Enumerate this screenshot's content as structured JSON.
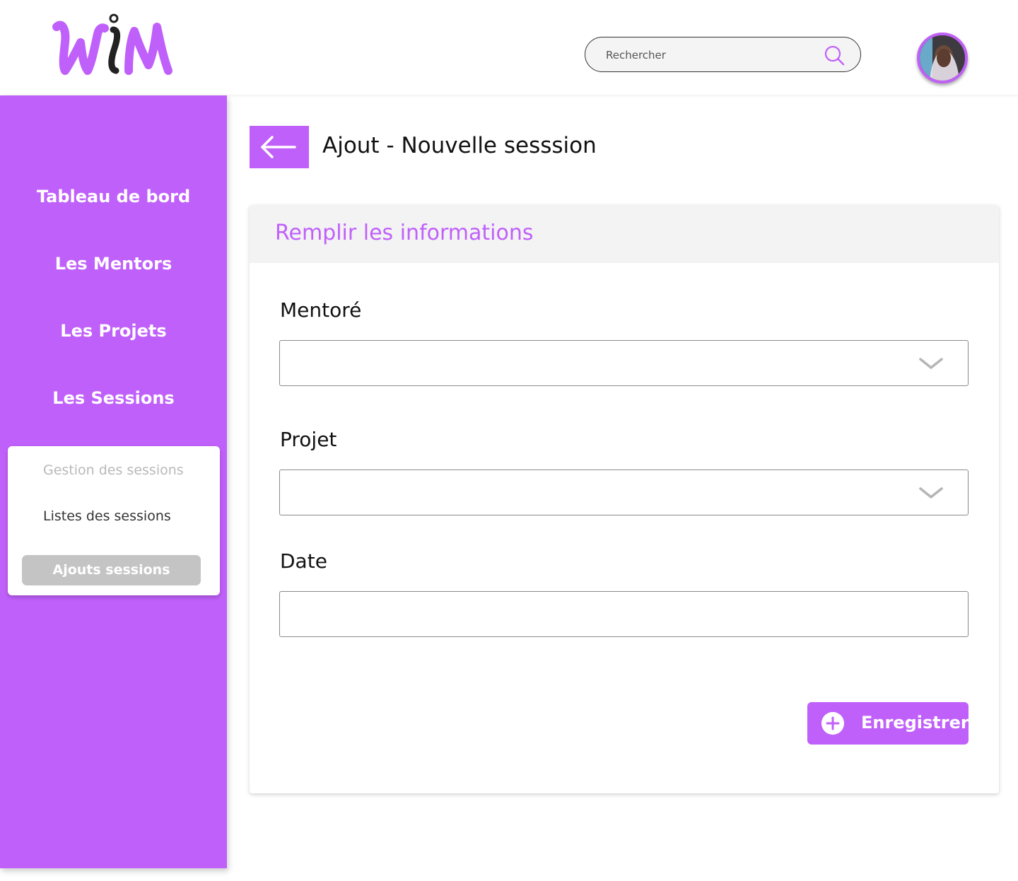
{
  "header": {
    "logo_text": "WiM",
    "search": {
      "placeholder": "Rechercher"
    }
  },
  "sidebar": {
    "items": [
      {
        "label": "Tableau de bord"
      },
      {
        "label": "Les Mentors"
      },
      {
        "label": "Les Projets"
      },
      {
        "label": "Les Sessions"
      }
    ],
    "submenu": {
      "title": "Gestion des sessions",
      "items": [
        {
          "label": "Listes des sessions"
        },
        {
          "label": "Ajouts sessions",
          "active": true
        }
      ]
    }
  },
  "main": {
    "title": "Ajout - Nouvelle sesssion",
    "card": {
      "title": "Remplir les informations",
      "fields": [
        {
          "label": "Mentoré",
          "type": "select",
          "value": ""
        },
        {
          "label": "Projet",
          "type": "select",
          "value": ""
        },
        {
          "label": "Date",
          "type": "input",
          "value": ""
        }
      ],
      "save_label": "Enregistrer"
    }
  },
  "colors": {
    "accent": "#c060fa",
    "active_bg": "#c4c4c4",
    "header_bg": "#f3f3f3"
  },
  "icons": [
    "search-icon",
    "back-arrow-icon",
    "chevron-down-icon",
    "plus-circle-icon"
  ]
}
